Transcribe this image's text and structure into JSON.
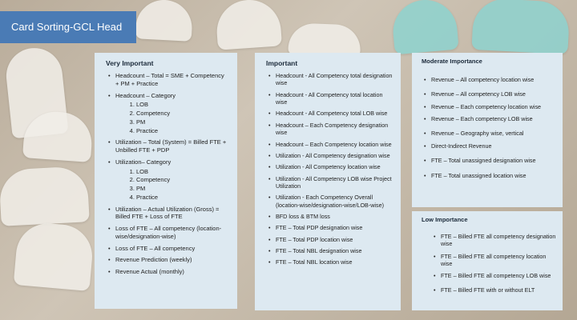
{
  "title": "Card Sorting-GCL Head",
  "panels": {
    "very_important": {
      "heading": "Very Important",
      "items": [
        {
          "text": "Headcount – Total = SME + Competency + PM + Practice"
        },
        {
          "text": "Headcount – Category",
          "sub": [
            "LOB",
            "Competency",
            "PM",
            "Practice"
          ]
        },
        {
          "text": "Utilization – Total (System) = Billed FTE + Unbilled FTE + PDP"
        },
        {
          "text": "Utilization– Category",
          "sub": [
            "LOB",
            "Competency",
            "PM",
            "Practice"
          ]
        },
        {
          "text": "Utilization – Actual Utilization (Gross) = Billed FTE + Loss of FTE"
        },
        {
          "text": "Loss of FTE – All competency (location-wise/designation-wise)"
        },
        {
          "text": "Loss of FTE – All competency"
        },
        {
          "text": "Revenue Prediction (weekly)"
        },
        {
          "text": "Revenue Actual (monthly)"
        }
      ]
    },
    "important": {
      "heading": "Important",
      "items": [
        "Headcount - All Competency total designation wise",
        "Headcount - All Competency total location wise",
        "Headcount - All Competency total LOB wise",
        "Headcount – Each Competency designation wise",
        "Headcount – Each Competency location wise",
        "Utilization - All Competency designation wise",
        "Utilization - All Competency location wise",
        "Utilization - All Competency LOB wise Project Utilization",
        "Utilization - Each Competency Overall (location-wise/designation-wise/LOB-wise)",
        "BFD loss & BTM loss",
        "FTE – Total PDP designation wise",
        "FTE – Total PDP location wise",
        "FTE – Total NBL designation wise",
        "FTE – Total NBL location wise"
      ]
    },
    "moderate": {
      "heading": "Moderate Importance",
      "items": [
        "Revenue – All competency location wise",
        "Revenue – All competency LOB wise",
        "Revenue – Each competency location wise",
        "Revenue – Each competency LOB wise",
        "Revenue – Geography wise, vertical",
        "Direct-Indirect Revenue",
        "FTE – Total unassigned designation wise",
        "FTE – Total unassigned location wise"
      ]
    },
    "low": {
      "heading": "Low Importance",
      "items": [
        "FTE – Billed FTE all competency designation wise",
        "FTE – Billed FTE all competency location wise",
        "FTE – Billed FTE all competency LOB wise",
        "FTE – Billed FTE with or without ELT"
      ]
    }
  }
}
